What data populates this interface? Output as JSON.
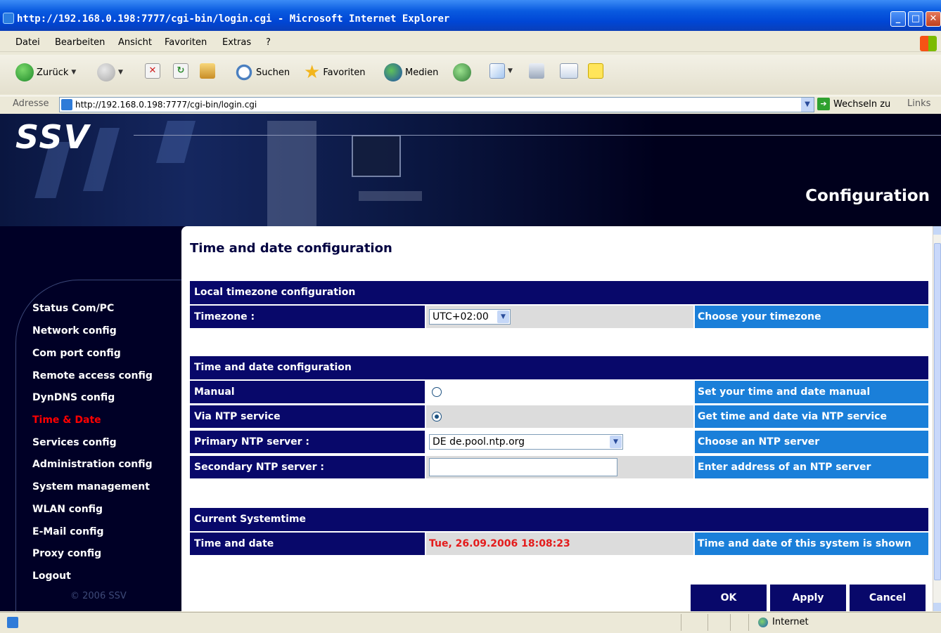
{
  "window": {
    "title": "http://192.168.0.198:7777/cgi-bin/login.cgi - Microsoft Internet Explorer"
  },
  "menubar": [
    "Datei",
    "Bearbeiten",
    "Ansicht",
    "Favoriten",
    "Extras",
    "?"
  ],
  "toolbar": {
    "back": "Zurück",
    "search": "Suchen",
    "favorites": "Favoriten",
    "media": "Medien"
  },
  "addressbar": {
    "label": "Adresse",
    "url": "http://192.168.0.198:7777/cgi-bin/login.cgi",
    "go": "Wechseln zu",
    "links": "Links"
  },
  "header": {
    "logo": "SSV",
    "title": "Configuration"
  },
  "sidebar": {
    "items": [
      {
        "label": "Status Com/PC",
        "active": false
      },
      {
        "label": "Network config",
        "active": false
      },
      {
        "label": "Com port config",
        "active": false
      },
      {
        "label": "Remote access config",
        "active": false
      },
      {
        "label": "DynDNS config",
        "active": false
      },
      {
        "label": "Time & Date",
        "active": true
      },
      {
        "label": "Services config",
        "active": false
      },
      {
        "label": "Administration config",
        "active": false
      },
      {
        "label": "System management",
        "active": false
      },
      {
        "label": "WLAN config",
        "active": false
      },
      {
        "label": "E-Mail config",
        "active": false
      },
      {
        "label": "Proxy config",
        "active": false
      },
      {
        "label": "Logout",
        "active": false
      }
    ],
    "copyright": "© 2006 SSV"
  },
  "main": {
    "title": "Time and date configuration",
    "timezone_section": {
      "header": "Local timezone configuration",
      "label": "Timezone :",
      "value": "UTC+02:00",
      "hint": "Choose your timezone"
    },
    "timedate_section": {
      "header": "Time and date configuration",
      "manual": {
        "label": "Manual",
        "checked": false,
        "hint": "Set your time and date manual"
      },
      "ntp": {
        "label": "Via NTP service",
        "checked": true,
        "hint": "Get time and date via NTP service"
      },
      "primary": {
        "label": "Primary NTP server :",
        "value": "DE de.pool.ntp.org",
        "hint": "Choose an NTP server"
      },
      "secondary": {
        "label": "Secondary NTP server :",
        "value": "",
        "hint": "Enter address of an NTP server"
      }
    },
    "systime_section": {
      "header": "Current Systemtime",
      "label": "Time and date",
      "value": "Tue, 26.09.2006 18:08:23",
      "hint": "Time and date of this system is shown"
    },
    "buttons": {
      "ok": "OK",
      "apply": "Apply",
      "cancel": "Cancel"
    }
  },
  "statusbar": {
    "zone": "Internet"
  }
}
